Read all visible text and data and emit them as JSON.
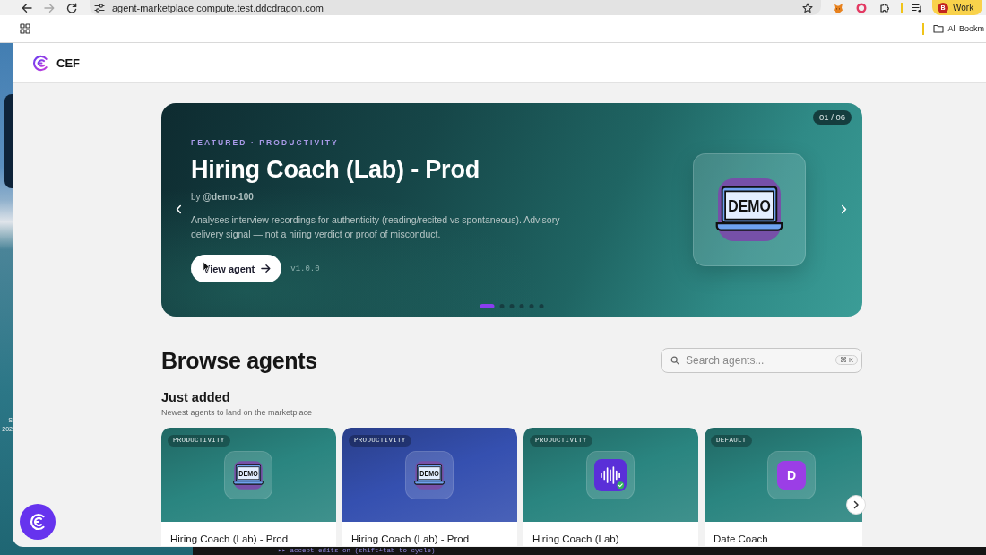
{
  "browser": {
    "nav_buttons": [
      {
        "kind": "back",
        "disabled": false
      },
      {
        "kind": "forward",
        "disabled": true
      },
      {
        "kind": "reload",
        "disabled": false
      }
    ],
    "url": "agent-marketplace.compute.test.ddcdragon.com",
    "profile": {
      "initial": "B",
      "label": "Work"
    },
    "bookmarks_label": "All Bookm"
  },
  "desktop": {
    "labels": [
      "S",
      "202"
    ]
  },
  "header": {
    "brand": "CEF"
  },
  "hero": {
    "counter": "01 / 06",
    "eyebrow": "FEATURED · PRODUCTIVITY",
    "title": "Hiring Coach (Lab) - Prod",
    "byline": "by **@demo-100**",
    "description": "Analyses interview recordings for authenticity (reading/recited vs spontaneous). Advisory delivery signal — not a hiring verdict or proof of misconduct.",
    "button": "View agent",
    "version": "v1.0.0",
    "icon": {
      "kind": "laptop",
      "text": "DEMO"
    },
    "slides": [
      {
        "selected": true
      },
      {
        "selected": false
      },
      {
        "selected": false
      },
      {
        "selected": false
      },
      {
        "selected": false
      },
      {
        "selected": false
      }
    ]
  },
  "browse": {
    "title": "Browse agents",
    "search": {
      "placeholder": "Search agents...",
      "shortcut": "⌘ K"
    }
  },
  "just_added": {
    "title": "Just added",
    "subtitle": "Newest agents to land on the marketplace",
    "cards": [
      {
        "tag": "PRODUCTIVITY",
        "title": "Hiring Coach (Lab) - Prod",
        "color": "#2a8580",
        "icon": {
          "kind": "laptop",
          "text": "DEMO"
        }
      },
      {
        "tag": "PRODUCTIVITY",
        "title": "Hiring Coach (Lab) - Prod",
        "color": "#3550b0",
        "icon": {
          "kind": "laptop",
          "text": "DEMO"
        }
      },
      {
        "tag": "PRODUCTIVITY",
        "title": "Hiring Coach (Lab)",
        "color": "#2a8580",
        "icon": {
          "kind": "waveform"
        }
      },
      {
        "tag": "DEFAULT",
        "title": "Date Coach",
        "color": "#2a8580",
        "icon": {
          "kind": "letter",
          "text": "D"
        }
      }
    ]
  },
  "terminal": {
    "status": "▸▸ accept edits on (shift+tab to cycle)"
  }
}
